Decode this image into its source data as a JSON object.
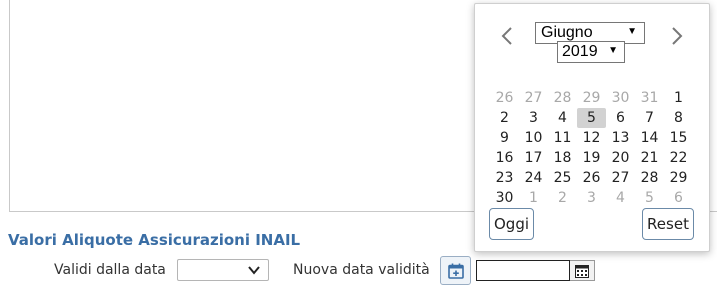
{
  "form": {
    "section_title": "Valori Aliquote Assicurazioni INAIL",
    "validi_label": "Validi dalla data",
    "validi_value": "",
    "nuova_label": "Nuova data validità",
    "nuova_value": ""
  },
  "datepicker": {
    "month": "Giugno",
    "year": "2019",
    "today_button": "Oggi",
    "reset_button": "Reset",
    "selected_day": "5",
    "weeks": [
      [
        {
          "d": "26",
          "m": true
        },
        {
          "d": "27",
          "m": true
        },
        {
          "d": "28",
          "m": true
        },
        {
          "d": "29",
          "m": true
        },
        {
          "d": "30",
          "m": true
        },
        {
          "d": "31",
          "m": true
        },
        {
          "d": "1",
          "m": false
        }
      ],
      [
        {
          "d": "2",
          "m": false
        },
        {
          "d": "3",
          "m": false
        },
        {
          "d": "4",
          "m": false
        },
        {
          "d": "5",
          "m": false,
          "s": true
        },
        {
          "d": "6",
          "m": false
        },
        {
          "d": "7",
          "m": false
        },
        {
          "d": "8",
          "m": false
        }
      ],
      [
        {
          "d": "9",
          "m": false
        },
        {
          "d": "10",
          "m": false
        },
        {
          "d": "11",
          "m": false
        },
        {
          "d": "12",
          "m": false
        },
        {
          "d": "13",
          "m": false
        },
        {
          "d": "14",
          "m": false
        },
        {
          "d": "15",
          "m": false
        }
      ],
      [
        {
          "d": "16",
          "m": false
        },
        {
          "d": "17",
          "m": false
        },
        {
          "d": "18",
          "m": false
        },
        {
          "d": "19",
          "m": false
        },
        {
          "d": "20",
          "m": false
        },
        {
          "d": "21",
          "m": false
        },
        {
          "d": "22",
          "m": false
        }
      ],
      [
        {
          "d": "23",
          "m": false
        },
        {
          "d": "24",
          "m": false
        },
        {
          "d": "25",
          "m": false
        },
        {
          "d": "26",
          "m": false
        },
        {
          "d": "27",
          "m": false
        },
        {
          "d": "28",
          "m": false
        },
        {
          "d": "29",
          "m": false
        }
      ],
      [
        {
          "d": "30",
          "m": false
        },
        {
          "d": "1",
          "m": true
        },
        {
          "d": "2",
          "m": true
        },
        {
          "d": "3",
          "m": true
        },
        {
          "d": "4",
          "m": true
        },
        {
          "d": "5",
          "m": true
        },
        {
          "d": "6",
          "m": true
        }
      ]
    ]
  },
  "colors": {
    "section_title": "#3a6ea5",
    "selected_day_bg": "#d2d2d2",
    "muted_day": "#a8a8a8"
  }
}
